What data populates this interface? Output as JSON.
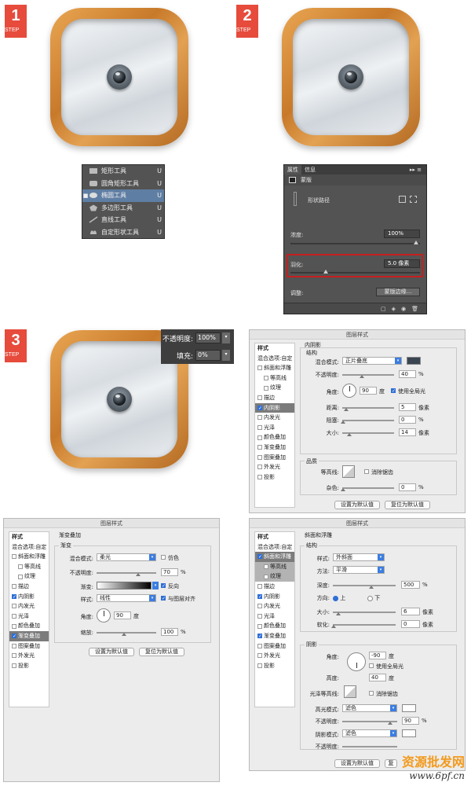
{
  "steps": [
    {
      "num": "1",
      "label": "STEP"
    },
    {
      "num": "2",
      "label": "STEP"
    },
    {
      "num": "3",
      "label": "STEP"
    }
  ],
  "tool_menu": {
    "items": [
      {
        "name": "矩形工具",
        "key": "U",
        "selected": false
      },
      {
        "name": "圆角矩形工具",
        "key": "U",
        "selected": false
      },
      {
        "name": "椭圆工具",
        "key": "U",
        "selected": true
      },
      {
        "name": "多边形工具",
        "key": "U",
        "selected": false
      },
      {
        "name": "直线工具",
        "key": "U",
        "selected": false
      },
      {
        "name": "自定形状工具",
        "key": "U",
        "selected": false
      }
    ]
  },
  "properties": {
    "tabs": [
      "属性",
      "信息"
    ],
    "section": "蒙版",
    "shape_path": "形状路径",
    "density_label": "浓度:",
    "density_value": "100%",
    "feather_label": "羽化:",
    "feather_value": "5.0 像素",
    "adjust_label": "调整:",
    "mask_edge_button": "蒙版边缘..."
  },
  "opacity_fill": {
    "opacity_label": "不透明度:",
    "opacity_value": "100%",
    "fill_label": "填充:",
    "fill_value": "0%"
  },
  "dialog_title": "图层样式",
  "inner_shadow_dialog": {
    "side": [
      "样式",
      "混合选项:自定",
      "斜面和浮雕",
      "等高线",
      "纹理",
      "描边",
      "内阴影",
      "内发光",
      "光泽",
      "颜色叠加",
      "渐变叠加",
      "图案叠加",
      "外发光",
      "投影"
    ],
    "section_title": "内阴影",
    "structure": "结构",
    "blend_mode_label": "混合模式:",
    "blend_mode": "正片叠底",
    "opacity_label": "不透明度:",
    "opacity": "40",
    "angle_label": "角度:",
    "angle": "90",
    "degree": "度",
    "global_light": "使用全局光",
    "distance_label": "距离:",
    "distance": "5",
    "choke_label": "阻塞:",
    "choke": "0",
    "size_label": "大小:",
    "size": "14",
    "px": "像素",
    "pct": "%",
    "quality": "品质",
    "contour_label": "等高线:",
    "anti_alias": "消除锯齿",
    "noise_label": "杂色:",
    "noise": "0",
    "make_default": "设置为默认值",
    "reset_default": "复位为默认值",
    "shadow_color": "#3a4552"
  },
  "gradient_dialog": {
    "side": [
      "样式",
      "混合选项:自定",
      "斜面和浮雕",
      "等高线",
      "纹理",
      "描边",
      "内阴影",
      "内发光",
      "光泽",
      "颜色叠加",
      "渐变叠加",
      "图案叠加",
      "外发光",
      "投影"
    ],
    "section_title": "渐变叠加",
    "sub_title": "渐变",
    "blend_mode_label": "混合模式:",
    "blend_mode": "柔光",
    "dither": "仿色",
    "opacity_label": "不透明度:",
    "opacity": "70",
    "gradient_label": "渐变:",
    "reverse": "反向",
    "style_label": "样式:",
    "style": "线性",
    "align": "与图层对齐",
    "angle_label": "角度:",
    "angle": "90",
    "degree": "度",
    "scale_label": "缩放:",
    "scale": "100",
    "pct": "%",
    "make_default": "设置为默认值",
    "reset_default": "复位为默认值"
  },
  "bevel_dialog": {
    "side": [
      "样式",
      "混合选项:自定",
      "斜面和浮雕",
      "等高线",
      "纹理",
      "描边",
      "内阴影",
      "内发光",
      "光泽",
      "颜色叠加",
      "渐变叠加",
      "图案叠加",
      "外发光",
      "投影"
    ],
    "section_title": "斜面和浮雕",
    "structure": "结构",
    "style_label": "样式:",
    "style": "外斜面",
    "method_label": "方法:",
    "method": "平滑",
    "depth_label": "深度:",
    "depth": "500",
    "direction_label": "方向:",
    "up": "上",
    "down": "下",
    "size_label": "大小:",
    "size": "6",
    "soften_label": "软化:",
    "soften": "0",
    "px": "像素",
    "pct": "%",
    "shading": "阴影",
    "angle_label": "角度:",
    "angle": "-90",
    "degree": "度",
    "global_light": "使用全局光",
    "altitude_label": "高度:",
    "altitude": "40",
    "gloss_label": "光泽等高线:",
    "anti_alias": "消除锯齿",
    "highlight_mode_label": "高光模式:",
    "highlight_mode": "滤色",
    "highlight_opacity_label": "不透明度:",
    "highlight_opacity": "90",
    "shadow_mode_label": "阴影模式:",
    "shadow_mode": "滤色",
    "shadow_opacity_label": "不透明度:",
    "make_default": "设置为默认值",
    "reset_default_partial": "复"
  },
  "watermark": {
    "line1": "资源批发网",
    "line2": "www.6pf.cn"
  },
  "colors": {
    "step_red": "#e64b3c",
    "wood": "#c87a2a",
    "ps_dark": "#535353",
    "highlight_red": "#c71e1e"
  }
}
